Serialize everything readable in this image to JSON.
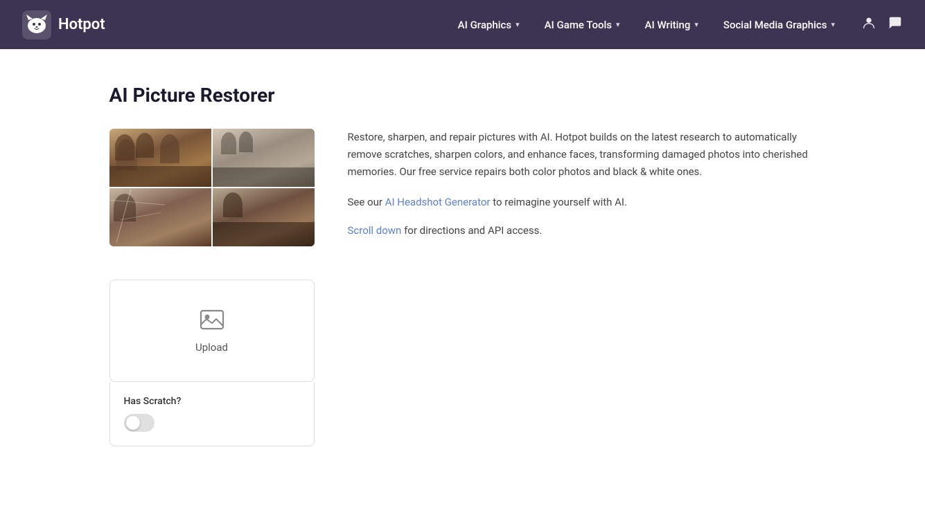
{
  "brand": {
    "name": "Hotpot"
  },
  "navbar": {
    "items": [
      {
        "id": "ai-graphics",
        "label": "AI Graphics",
        "has_chevron": true
      },
      {
        "id": "ai-game-tools",
        "label": "AI Game Tools",
        "has_chevron": true
      },
      {
        "id": "ai-writing",
        "label": "AI Writing",
        "has_chevron": true
      },
      {
        "id": "social-media-graphics",
        "label": "Social Media Graphics",
        "has_chevron": true
      }
    ]
  },
  "page": {
    "title": "AI Picture Restorer",
    "description": "Restore, sharpen, and repair pictures with AI. Hotpot builds on the latest research to automatically remove scratches, sharpen colors, and enhance faces, transforming damaged photos into cherished memories. Our free service repairs both color photos and black & white ones.",
    "see_our_text": "See our",
    "headshot_link": "AI Headshot Generator",
    "headshot_suffix": "to reimagine yourself with AI.",
    "scroll_link": "Scroll down",
    "scroll_suffix": "for directions and API access."
  },
  "upload": {
    "label": "Upload"
  },
  "options": {
    "has_scratch_label": "Has Scratch?",
    "toggle_state": false
  },
  "icons": {
    "user": "👤",
    "chat": "💬"
  }
}
